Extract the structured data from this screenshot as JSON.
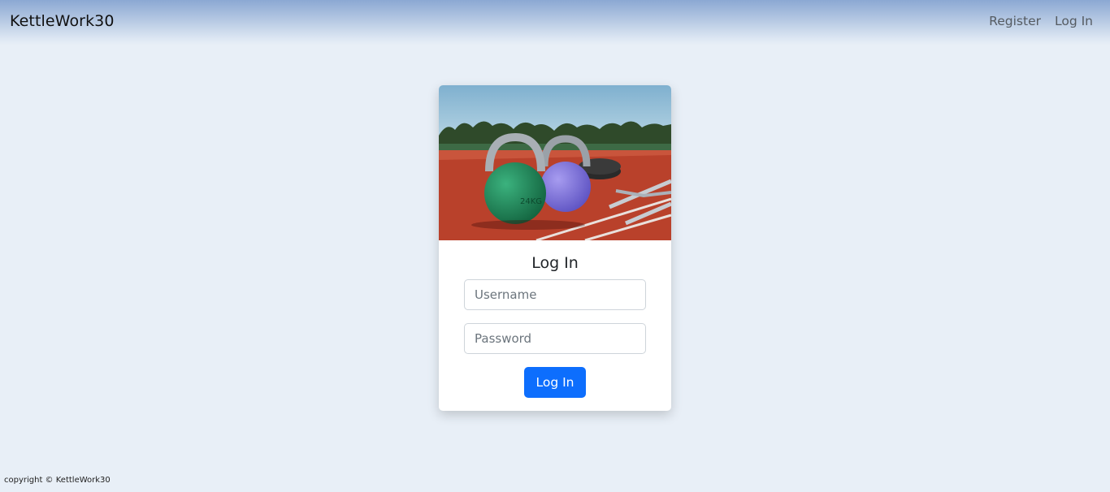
{
  "navbar": {
    "brand": "KettleWork30",
    "links": [
      {
        "label": "Register"
      },
      {
        "label": "Log In"
      }
    ]
  },
  "login_card": {
    "image_icon": "kettlebells-on-track-photo",
    "image_text": "24KG",
    "title": "Log In",
    "username": {
      "value": "",
      "placeholder": "Username"
    },
    "password": {
      "value": "",
      "placeholder": "Password"
    },
    "submit_label": "Log In"
  },
  "footer": {
    "text": "copyright © KettleWork30"
  },
  "colors": {
    "background": "#e8eff7",
    "primary_button": "#0d6efd",
    "track": "#b9412b",
    "green_kettlebell": "#1f8a5a",
    "purple_kettlebell": "#7b6fd6"
  }
}
